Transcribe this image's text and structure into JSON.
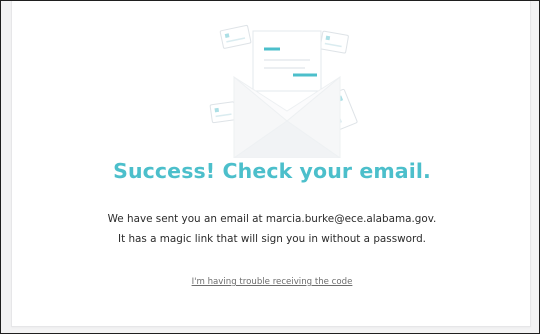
{
  "success": {
    "title": "Success! Check your email.",
    "message": "We have sent you an email at marcia.burke@ece.alabama.gov. It has a magic link that will sign you in without a password.",
    "help_link": "I'm having trouble receiving the code",
    "illustration_icon": "envelope-with-letters-icon"
  },
  "colors": {
    "accent": "#4cbfcb",
    "text": "#2b2b2b",
    "muted_link": "#6d6d6d",
    "background": "#f3f3f4",
    "card": "#ffffff"
  }
}
